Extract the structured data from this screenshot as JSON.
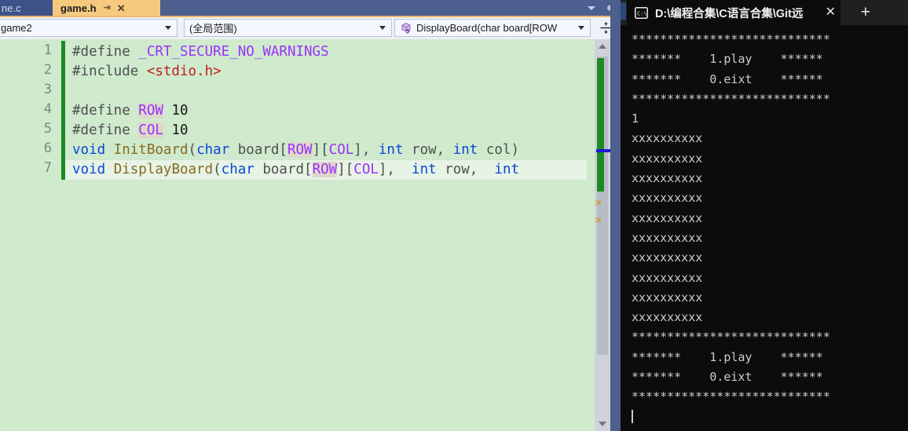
{
  "editor": {
    "tabs": [
      {
        "label": "ne.c",
        "active": false,
        "name": "tab-game-c"
      },
      {
        "label": "game.h",
        "active": true,
        "name": "tab-game-h",
        "pin": "⇥",
        "close": "✕"
      }
    ],
    "tabstrip_icons": {
      "overflow": "chevron-down-icon",
      "settings": "gear-icon"
    },
    "navbar": {
      "project": "game2",
      "scope": "(全局范围)",
      "member": "DisplayBoard(char board[ROW",
      "member_icon": "method-cube-icon",
      "split_icon": "split-window-icon"
    },
    "line_numbers": [
      "1",
      "2",
      "3",
      "4",
      "5",
      "6",
      "7"
    ],
    "current_line": 7,
    "code": [
      [
        {
          "t": "#define ",
          "c": "dir"
        },
        {
          "t": "_CRT_SECURE_NO_WARNINGS",
          "c": "macro"
        }
      ],
      [
        {
          "t": "#include ",
          "c": "dir"
        },
        {
          "t": "<stdio.h>",
          "c": "str"
        }
      ],
      [],
      [
        {
          "t": "#define ",
          "c": "dir"
        },
        {
          "t": "ROW",
          "c": "macro",
          "hl": true
        },
        {
          "t": " 10",
          "c": "num"
        }
      ],
      [
        {
          "t": "#define ",
          "c": "dir"
        },
        {
          "t": "COL",
          "c": "macro",
          "hl": true
        },
        {
          "t": " 10",
          "c": "num"
        }
      ],
      [
        {
          "t": "void ",
          "c": "kw"
        },
        {
          "t": "InitBoard",
          "c": "fn"
        },
        {
          "t": "(",
          "c": "plain"
        },
        {
          "t": "char",
          "c": "kw"
        },
        {
          "t": " board[",
          "c": "plain"
        },
        {
          "t": "ROW",
          "c": "macro",
          "hl": true
        },
        {
          "t": "][",
          "c": "plain"
        },
        {
          "t": "COL",
          "c": "macro"
        },
        {
          "t": "], ",
          "c": "plain"
        },
        {
          "t": "int",
          "c": "kw"
        },
        {
          "t": " row, ",
          "c": "plain"
        },
        {
          "t": "int",
          "c": "kw"
        },
        {
          "t": " col)",
          "c": "plain"
        }
      ],
      [
        {
          "t": "void ",
          "c": "kw"
        },
        {
          "t": "DisplayBoard",
          "c": "fn"
        },
        {
          "t": "(",
          "c": "plain"
        },
        {
          "t": "char",
          "c": "kw"
        },
        {
          "t": " board[",
          "c": "plain"
        },
        {
          "t": "ROW",
          "c": "macro",
          "hl": true
        },
        {
          "t": "][",
          "c": "plain"
        },
        {
          "t": "COL",
          "c": "macro"
        },
        {
          "t": "],  ",
          "c": "plain"
        },
        {
          "t": "int",
          "c": "kw"
        },
        {
          "t": " row,  ",
          "c": "plain"
        },
        {
          "t": "int",
          "c": "kw"
        }
      ]
    ],
    "scrollbar": {
      "up_arrow": "scroll-up-arrow-icon",
      "down_arrow": "scroll-down-arrow-icon"
    }
  },
  "console": {
    "tab": {
      "title": "D:\\编程合集\\C语言合集\\Git远",
      "icon": "cmd-prompt-icon",
      "close": "✕"
    },
    "new_tab_label": "+",
    "output": [
      "****************************",
      "*******    1.play    ******",
      "*******    0.eixt    ******",
      "****************************",
      "1",
      "xxxxxxxxxx",
      "xxxxxxxxxx",
      "xxxxxxxxxx",
      "xxxxxxxxxx",
      "xxxxxxxxxx",
      "xxxxxxxxxx",
      "xxxxxxxxxx",
      "xxxxxxxxxx",
      "xxxxxxxxxx",
      "xxxxxxxxxx",
      "****************************",
      "*******    1.play    ******",
      "*******    0.eixt    ******",
      "****************************"
    ]
  },
  "colors": {
    "vs_chrome": "#4d5f8e",
    "active_tab": "#f5ca7f",
    "code_bg": "#cfeacd",
    "change_bar": "#1d8b23",
    "console_bg": "#0c0c0c"
  }
}
